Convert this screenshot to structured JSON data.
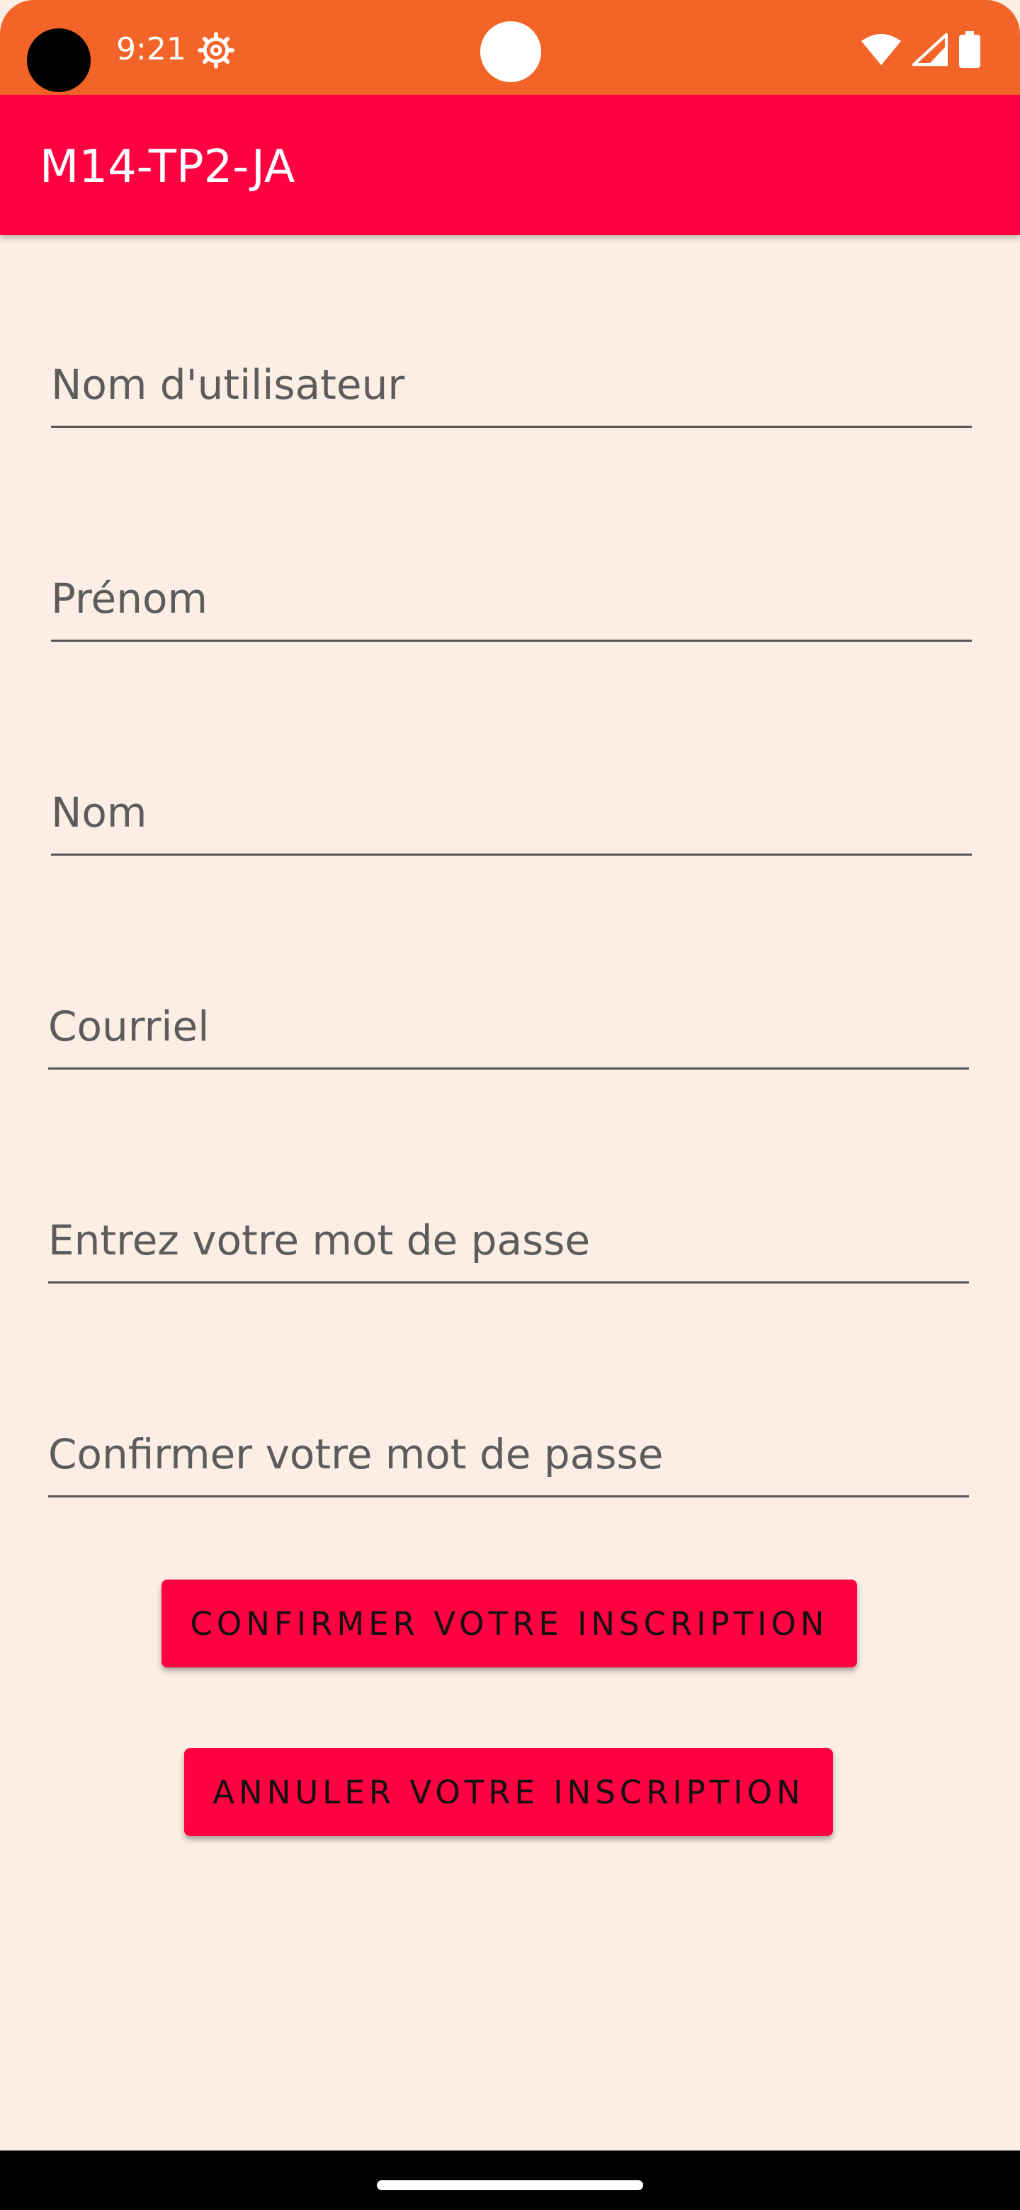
{
  "status_bar": {
    "time": "9:21",
    "background_color": "#F26427",
    "icons": [
      "settings-gear-icon",
      "wifi-icon",
      "cell-signal-icon",
      "battery-icon"
    ]
  },
  "app_bar": {
    "title": "M14-TP2-JA",
    "background_color": "#FF0140"
  },
  "form": {
    "username": {
      "placeholder": "Nom d'utilisateur",
      "value": ""
    },
    "first_name": {
      "placeholder": "Prénom",
      "value": ""
    },
    "last_name": {
      "placeholder": "Nom",
      "value": ""
    },
    "email": {
      "placeholder": "Courriel",
      "value": ""
    },
    "password": {
      "placeholder": "Entrez votre mot de passe",
      "value": ""
    },
    "confirm_password": {
      "placeholder": "Confirmer votre mot de passe",
      "value": ""
    }
  },
  "buttons": {
    "confirm_label": "CONFIRMER VOTRE INSCRIPTION",
    "cancel_label": "ANNULER VOTRE INSCRIPTION",
    "color": "#FF0140"
  },
  "colors": {
    "background": "#FCEEE4",
    "underline": "#555555",
    "placeholder_text": "#5C5C5C"
  }
}
